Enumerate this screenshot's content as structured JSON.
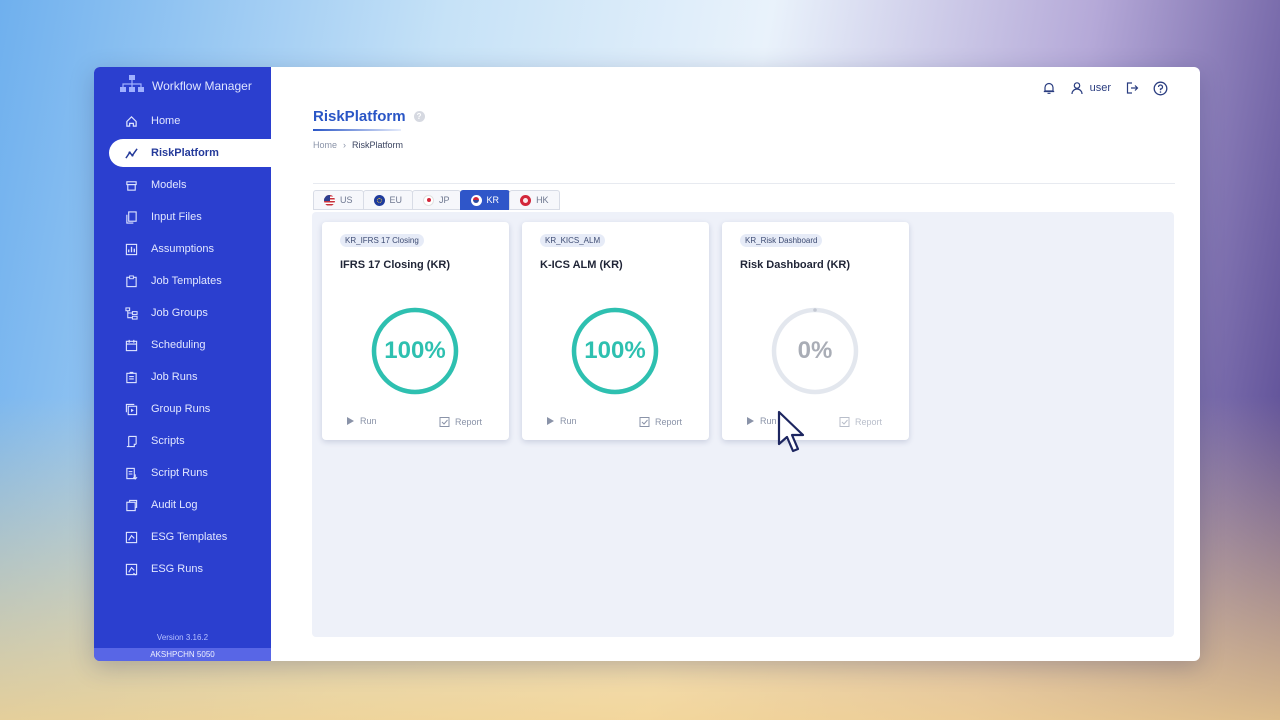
{
  "app": {
    "title": "Workflow Manager"
  },
  "sidebar": {
    "items": [
      {
        "label": "Home",
        "icon": "home-icon"
      },
      {
        "label": "RiskPlatform",
        "icon": "trend-icon",
        "active": true
      },
      {
        "label": "Models",
        "icon": "box-icon"
      },
      {
        "label": "Input Files",
        "icon": "files-icon"
      },
      {
        "label": "Assumptions",
        "icon": "chart-icon"
      },
      {
        "label": "Job Templates",
        "icon": "clipboard-icon"
      },
      {
        "label": "Job Groups",
        "icon": "hierarchy-icon"
      },
      {
        "label": "Scheduling",
        "icon": "calendar-icon"
      },
      {
        "label": "Job Runs",
        "icon": "clipboard-list-icon"
      },
      {
        "label": "Group Runs",
        "icon": "layers-icon"
      },
      {
        "label": "Scripts",
        "icon": "script-icon"
      },
      {
        "label": "Script Runs",
        "icon": "script-run-icon"
      },
      {
        "label": "Audit Log",
        "icon": "audit-icon"
      },
      {
        "label": "ESG Templates",
        "icon": "esg-template-icon"
      },
      {
        "label": "ESG Runs",
        "icon": "esg-run-icon"
      }
    ],
    "version": "Version 3.16.2",
    "host": "AKSHPCHN 5050"
  },
  "topbar": {
    "user": "user"
  },
  "page": {
    "title": "RiskPlatform"
  },
  "breadcrumb": {
    "home": "Home",
    "current": "RiskPlatform"
  },
  "tabs": [
    {
      "label": "US",
      "flag": "us"
    },
    {
      "label": "EU",
      "flag": "eu"
    },
    {
      "label": "JP",
      "flag": "jp"
    },
    {
      "label": "KR",
      "flag": "kr",
      "active": true
    },
    {
      "label": "HK",
      "flag": "hk"
    }
  ],
  "cards": [
    {
      "tag": "KR_IFRS 17 Closing",
      "title": "IFRS 17 Closing (KR)",
      "progress": 100,
      "progress_label": "100%",
      "run": "Run",
      "report": "Report"
    },
    {
      "tag": "KR_KICS_ALM",
      "title": "K-ICS ALM (KR)",
      "progress": 100,
      "progress_label": "100%",
      "run": "Run",
      "report": "Report"
    },
    {
      "tag": "KR_Risk Dashboard",
      "title": "Risk Dashboard (KR)",
      "progress": 0,
      "progress_label": "0%",
      "run": "Run",
      "report": "Report"
    }
  ],
  "colors": {
    "sidebar_bg": "#2b3fcf",
    "accent": "#2f56c9",
    "progress_complete": "#2ec0b0",
    "progress_empty": "#e3e7ee"
  }
}
